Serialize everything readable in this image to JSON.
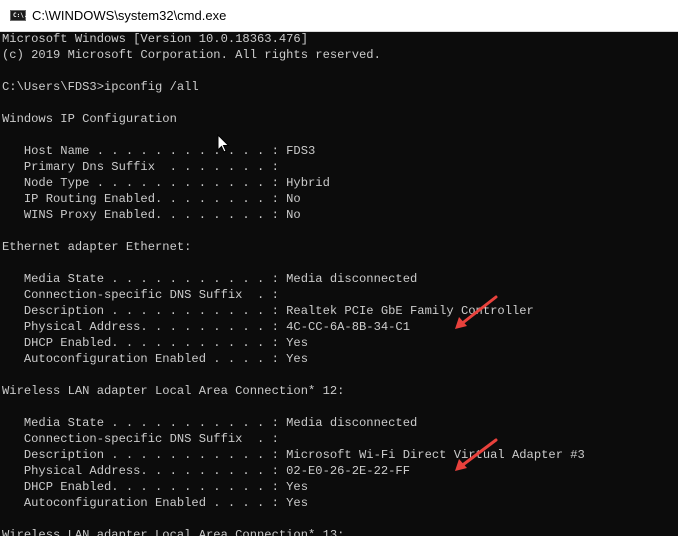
{
  "window": {
    "title": "C:\\WINDOWS\\system32\\cmd.exe",
    "icon": "cmd-icon",
    "icon_glyph": "C:\\."
  },
  "console": {
    "lines": [
      "Microsoft Windows [Version 10.0.18363.476]",
      "(c) 2019 Microsoft Corporation. All rights reserved.",
      "",
      "C:\\Users\\FDS3>ipconfig /all",
      "",
      "Windows IP Configuration",
      "",
      "   Host Name . . . . . . . . . . . . : FDS3",
      "   Primary Dns Suffix  . . . . . . . :",
      "   Node Type . . . . . . . . . . . . : Hybrid",
      "   IP Routing Enabled. . . . . . . . : No",
      "   WINS Proxy Enabled. . . . . . . . : No",
      "",
      "Ethernet adapter Ethernet:",
      "",
      "   Media State . . . . . . . . . . . : Media disconnected",
      "   Connection-specific DNS Suffix  . :",
      "   Description . . . . . . . . . . . : Realtek PCIe GbE Family Controller",
      "   Physical Address. . . . . . . . . : 4C-CC-6A-8B-34-C1",
      "   DHCP Enabled. . . . . . . . . . . : Yes",
      "   Autoconfiguration Enabled . . . . : Yes",
      "",
      "Wireless LAN adapter Local Area Connection* 12:",
      "",
      "   Media State . . . . . . . . . . . : Media disconnected",
      "   Connection-specific DNS Suffix  . :",
      "   Description . . . . . . . . . . . : Microsoft Wi-Fi Direct Virtual Adapter #3",
      "   Physical Address. . . . . . . . . : 02-E0-26-2E-22-FF",
      "   DHCP Enabled. . . . . . . . . . . : Yes",
      "   Autoconfiguration Enabled . . . . : Yes",
      "",
      "Wireless LAN adapter Local Area Connection* 13:"
    ]
  },
  "annotations": {
    "arrow_color": "#e8413c",
    "arrows": [
      {
        "points_to": "Ethernet Physical Address 4C-CC-6A-8B-34-C1"
      },
      {
        "points_to": "Wireless Physical Address 02-E0-26-2E-22-FF"
      }
    ]
  },
  "colors": {
    "console_bg": "#0c0c0c",
    "console_fg": "#cccccc",
    "titlebar_bg": "#ffffff"
  }
}
